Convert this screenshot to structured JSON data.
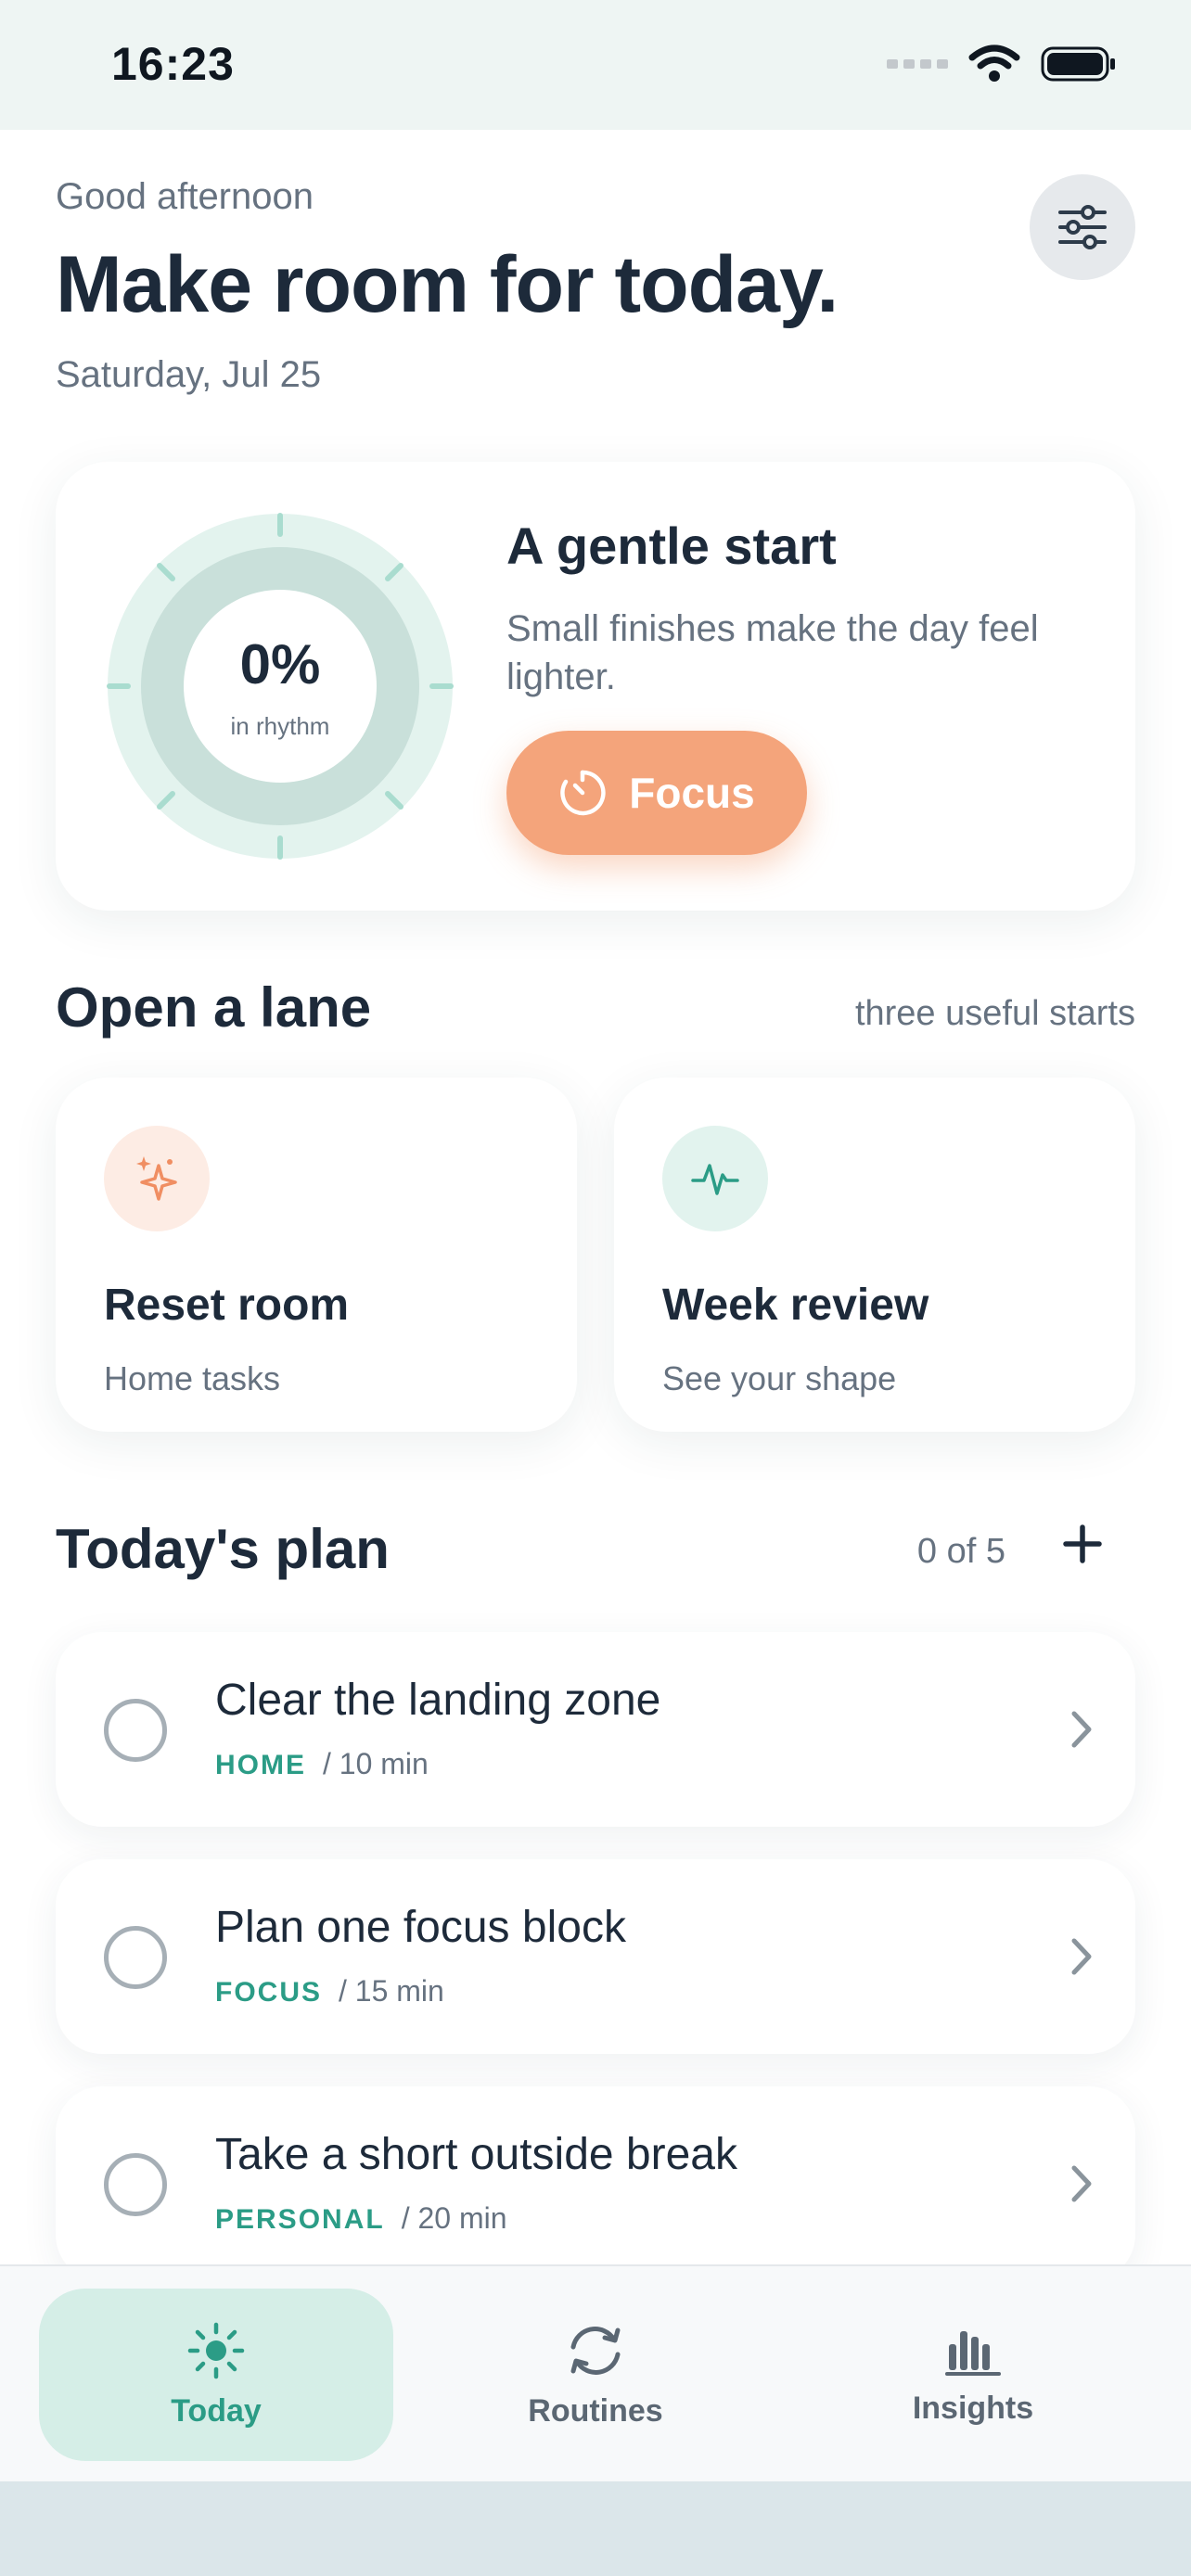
{
  "status_bar": {
    "time": "16:23"
  },
  "header": {
    "greeting": "Good afternoon",
    "title": "Make room for today.",
    "date": "Saturday, Jul 25"
  },
  "hero": {
    "progress_value": "0%",
    "progress_caption": "in rhythm",
    "title": "A gentle start",
    "body": "Small finishes make the day feel lighter.",
    "focus_label": "Focus"
  },
  "lanes": {
    "title": "Open a lane",
    "meta": "three useful starts",
    "items": [
      {
        "title": "Reset room",
        "subtitle": "Home tasks",
        "icon": "sparkles-icon",
        "icon_bg": "#fdece4",
        "icon_color": "#f08e62"
      },
      {
        "title": "Week review",
        "subtitle": "See your shape",
        "icon": "pulse-icon",
        "icon_bg": "#e2f3ee",
        "icon_color": "#2b9c86"
      }
    ]
  },
  "plan": {
    "title": "Today's plan",
    "count": "0 of 5",
    "tasks": [
      {
        "title": "Clear the landing zone",
        "category": "HOME",
        "duration": "/ 10 min"
      },
      {
        "title": "Plan one focus block",
        "category": "FOCUS",
        "duration": "/ 15 min"
      },
      {
        "title": "Take a short outside break",
        "category": "PERSONAL",
        "duration": "/ 20 min"
      }
    ]
  },
  "tab_bar": {
    "tabs": [
      {
        "label": "Today",
        "icon": "sun-icon",
        "active": true
      },
      {
        "label": "Routines",
        "icon": "refresh-icon",
        "active": false
      },
      {
        "label": "Insights",
        "icon": "bar-chart-icon",
        "active": false
      }
    ]
  },
  "colors": {
    "accent": "#2b9c86",
    "focus": "#f4a47b",
    "ink": "#1d2a3a",
    "muted": "#667280"
  }
}
